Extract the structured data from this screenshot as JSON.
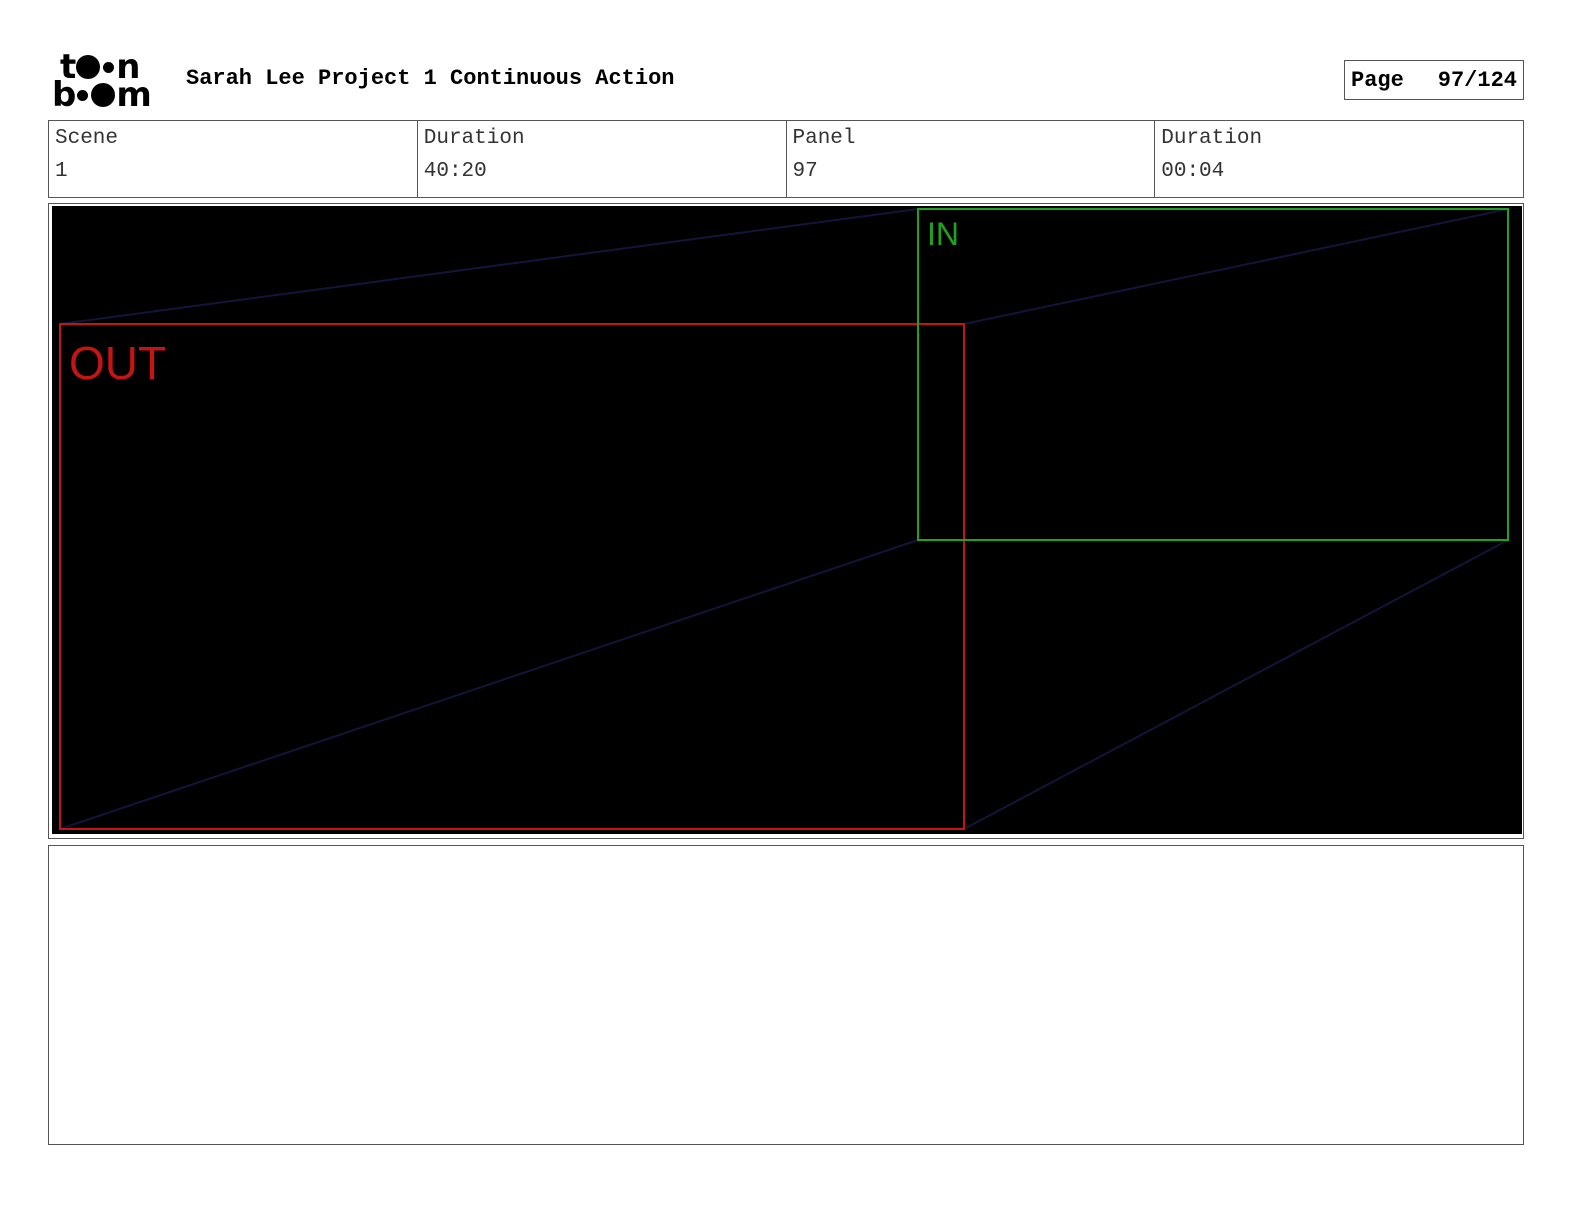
{
  "header": {
    "title": "Sarah Lee Project 1 Continuous Action",
    "page_label": "Page",
    "page_value": "97/124"
  },
  "logo": {
    "alt": "toon boom"
  },
  "info": {
    "scene_label": "Scene",
    "scene_value": "1",
    "scene_duration_label": "Duration",
    "scene_duration_value": "40:20",
    "panel_label": "Panel",
    "panel_value": "97",
    "panel_duration_label": "Duration",
    "panel_duration_value": "00:04"
  },
  "panel": {
    "in_label": "IN",
    "out_label": "OUT",
    "colors": {
      "in_frame": "#1fa31f",
      "out_frame": "#c41414",
      "guide_lines": "#14143a",
      "background": "#000000"
    }
  },
  "notes": {
    "text": ""
  }
}
